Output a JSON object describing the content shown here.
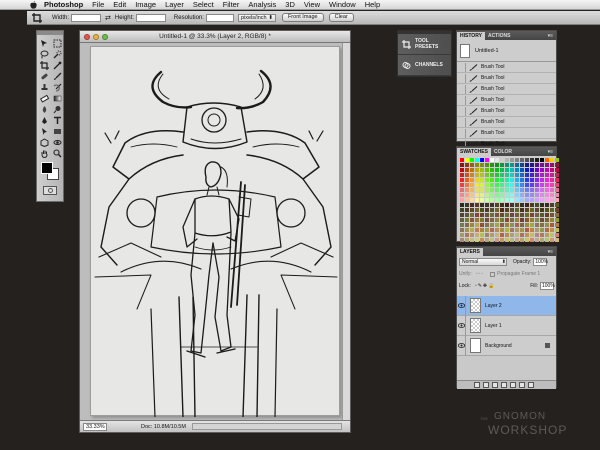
{
  "menubar": {
    "app": "Photoshop",
    "items": [
      "File",
      "Edit",
      "Image",
      "Layer",
      "Select",
      "Filter",
      "Analysis",
      "3D",
      "View",
      "Window",
      "Help"
    ]
  },
  "options": {
    "width_label": "Width:",
    "height_label": "Height:",
    "resolution_label": "Resolution:",
    "units": "pixels/inch",
    "front_image": "Front Image",
    "clear": "Clear"
  },
  "document": {
    "title": "Untitled-1 @ 33.3% (Layer 2, RGB/8) *",
    "zoom": "33.33%",
    "doc_info": "Doc: 10.8M/10.5M"
  },
  "dock": {
    "tool_presets": "TOOL PRESETS",
    "channels": "CHANNELS"
  },
  "history": {
    "tabs": [
      "HISTORY",
      "ACTIONS"
    ],
    "snapshot": "Untitled-1",
    "states": [
      "Brush Tool",
      "Brush Tool",
      "Brush Tool",
      "Brush Tool",
      "Brush Tool",
      "Brush Tool",
      "Brush Tool",
      "Brush Tool"
    ]
  },
  "swatches": {
    "tabs": [
      "SWATCHES",
      "COLOR"
    ]
  },
  "layers": {
    "tab": "LAYERS",
    "blend_mode": "Normal",
    "opacity_label": "Opacity:",
    "opacity": "100%",
    "unify_label": "Unify:",
    "propagate": "Propagate Frame 1",
    "lock_label": "Lock:",
    "fill_label": "Fill:",
    "fill": "100%",
    "items": [
      {
        "name": "Layer 2",
        "selected": true
      },
      {
        "name": "Layer 1",
        "selected": false
      },
      {
        "name": "Background",
        "selected": false
      }
    ]
  },
  "watermark": {
    "pre": "THE",
    "line1": "GNOMON",
    "line2": "WORKSHOP"
  },
  "colors": {
    "accent_selected": "#8fb7ea"
  }
}
